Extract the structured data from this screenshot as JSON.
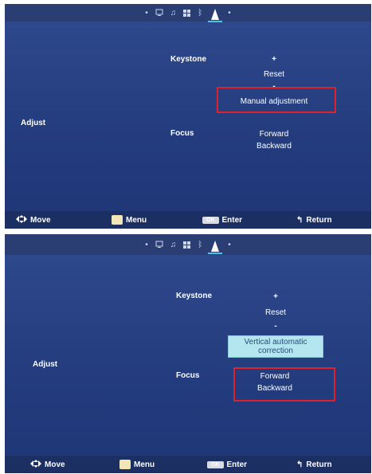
{
  "screens": [
    {
      "menu_icons": [
        "left-arrow-icon",
        "monitor-icon",
        "music-icon",
        "grid-icon",
        "bluetooth-icon",
        "keystone-icon",
        "right-arrow-icon"
      ],
      "section": "Adjust",
      "keystone": {
        "label": "Keystone",
        "plus": "+",
        "reset": "Reset",
        "minus": "-",
        "selected_option": "Manual adjustment"
      },
      "focus": {
        "label": "Focus",
        "forward": "Forward",
        "backward": "Backward"
      },
      "bottom_bar": {
        "move": "Move",
        "menu": "Menu",
        "ok_key": "OK",
        "enter": "Enter",
        "return": "Return"
      }
    },
    {
      "menu_icons": [
        "left-arrow-icon",
        "monitor-icon",
        "music-icon",
        "grid-icon",
        "bluetooth-icon",
        "keystone-icon",
        "right-arrow-icon"
      ],
      "section": "Adjust",
      "keystone": {
        "label": "Keystone",
        "plus": "+",
        "reset": "Reset",
        "minus": "-",
        "selected_option": "Vertical automatic correction"
      },
      "focus": {
        "label": "Focus",
        "forward": "Forward",
        "backward": "Backward"
      },
      "bottom_bar": {
        "move": "Move",
        "menu": "Menu",
        "ok_key": "OK",
        "enter": "Enter",
        "return": "Return"
      }
    }
  ],
  "colors": {
    "background": "#2a4589",
    "highlight_box": "#e0202a",
    "selection_bg": "#b4e6ef",
    "active_tab_underline": "#4fc2e8"
  }
}
